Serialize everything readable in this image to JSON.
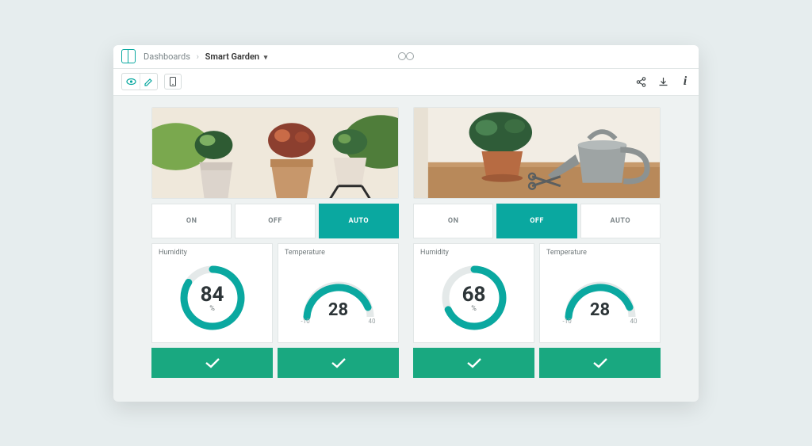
{
  "breadcrumb": {
    "root": "Dashboards",
    "current": "Smart Garden"
  },
  "panels": [
    {
      "modes": {
        "on": "ON",
        "off": "OFF",
        "auto": "AUTO",
        "active": "auto"
      },
      "humidity": {
        "label": "Humidity",
        "value": 84,
        "unit": "%",
        "max": 100
      },
      "temperature": {
        "label": "Temperature",
        "value": 28,
        "min": -10,
        "max": 40
      }
    },
    {
      "modes": {
        "on": "ON",
        "off": "OFF",
        "auto": "AUTO",
        "active": "off"
      },
      "humidity": {
        "label": "Humidity",
        "value": 68,
        "unit": "%",
        "max": 100
      },
      "temperature": {
        "label": "Temperature",
        "value": 28,
        "min": -10,
        "max": 40
      }
    }
  ],
  "colors": {
    "accent": "#0aa8a0",
    "confirm": "#19a880",
    "gaugeBg": "#e4e9e9"
  }
}
